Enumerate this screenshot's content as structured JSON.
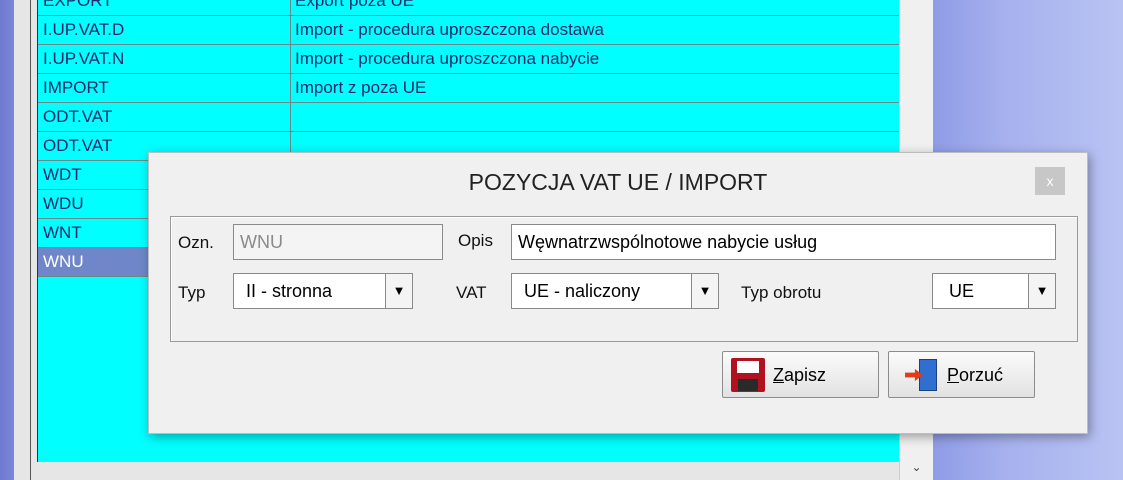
{
  "list": {
    "rows": [
      {
        "code": "EXPORT",
        "desc": "Export poza UE"
      },
      {
        "code": "I.UP.VAT.D",
        "desc": "Import - procedura uproszczona dostawa"
      },
      {
        "code": "I.UP.VAT.N",
        "desc": "Import - procedura uproszczona nabycie"
      },
      {
        "code": "IMPORT",
        "desc": "Import z poza UE"
      },
      {
        "code": "ODT.VAT",
        "desc": ""
      },
      {
        "code": "ODT.VAT",
        "desc": ""
      },
      {
        "code": "WDT",
        "desc": ""
      },
      {
        "code": "WDU",
        "desc": ""
      },
      {
        "code": "WNT",
        "desc": ""
      },
      {
        "code": "WNU",
        "desc": ""
      }
    ],
    "scroll_down_glyph": "⌄"
  },
  "dialog": {
    "title": "POZYCJA VAT UE / IMPORT",
    "close_glyph": "x",
    "ozn_label": "Ozn.",
    "ozn_value": "WNU",
    "opis_label": "Opis",
    "opis_value": "Węwnatrzwspólnotowe nabycie usług",
    "typ_label": "Typ",
    "typ_value": "II - stronna",
    "vat_label": "VAT",
    "vat_value": "UE - naliczony",
    "typ_obrotu_label": "Typ obrotu",
    "typ_obrotu_value": "UE",
    "dropdown_glyph": "▼",
    "save_mnemonic": "Z",
    "save_rest": "apisz",
    "cancel_mnemonic": "P",
    "cancel_rest": "orzuć"
  },
  "colors": {
    "grid_bg": "#00ffff",
    "selected_row": "#6f87c8",
    "text": "#1a2a6a"
  }
}
